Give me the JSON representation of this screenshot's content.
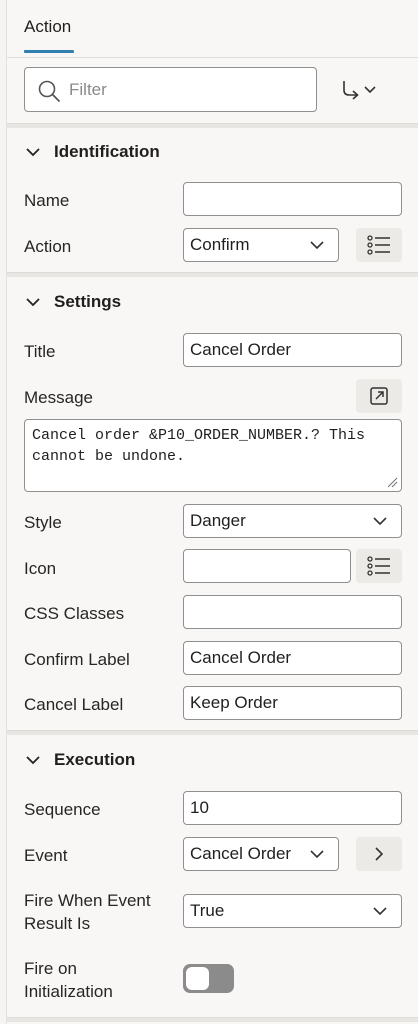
{
  "tab": {
    "label": "Action"
  },
  "filter": {
    "placeholder": "Filter",
    "value": ""
  },
  "sections": {
    "identification": {
      "title": "Identification",
      "name_label": "Name",
      "name_value": "",
      "action_label": "Action",
      "action_value": "Confirm"
    },
    "settings": {
      "title": "Settings",
      "title_label": "Title",
      "title_value": "Cancel Order",
      "message_label": "Message",
      "message_value": "Cancel order &P10_ORDER_NUMBER.? This\ncannot be undone.",
      "style_label": "Style",
      "style_value": "Danger",
      "icon_label": "Icon",
      "icon_value": "",
      "css_label": "CSS Classes",
      "css_value": "",
      "confirm_label": "Confirm Label",
      "confirm_value": "Cancel Order",
      "cancel_label": "Cancel Label",
      "cancel_value": "Keep Order"
    },
    "execution": {
      "title": "Execution",
      "sequence_label": "Sequence",
      "sequence_value": "10",
      "event_label": "Event",
      "event_value": "Cancel Order",
      "fire_when_label_line1": "Fire When Event",
      "fire_when_label_line2": "Result Is",
      "fire_when_value": "True",
      "fire_init_label_line1": "Fire on",
      "fire_init_label_line2": "Initialization",
      "fire_init_on": false
    }
  },
  "icons": {
    "search": "search-icon",
    "goto": "go-to-arrow-icon",
    "chevron": "chevron-down-icon",
    "list": "list-icon",
    "expand": "expand-icon",
    "next": "chevron-right-icon"
  },
  "colors": {
    "accent": "#2f7fb0",
    "toggle_off": "#8b8b8b"
  }
}
